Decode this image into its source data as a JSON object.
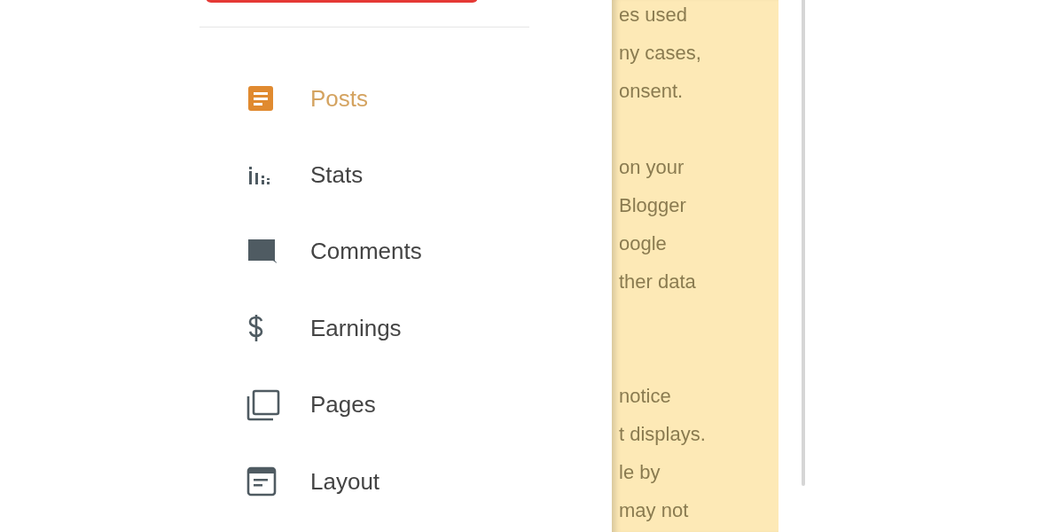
{
  "nav": [
    {
      "label": "Posts",
      "selected": true
    },
    {
      "label": "Stats",
      "selected": false
    },
    {
      "label": "Comments",
      "selected": false
    },
    {
      "label": "Earnings",
      "selected": false
    },
    {
      "label": "Pages",
      "selected": false
    },
    {
      "label": "Layout",
      "selected": false
    }
  ],
  "notice_paragraphs": [
    [
      "es used",
      "ny cases,",
      "onsent."
    ],
    [
      "on your",
      "Blogger",
      "oogle",
      "ther data"
    ],
    [
      "notice",
      "t displays.",
      "le by",
      "may not"
    ]
  ]
}
